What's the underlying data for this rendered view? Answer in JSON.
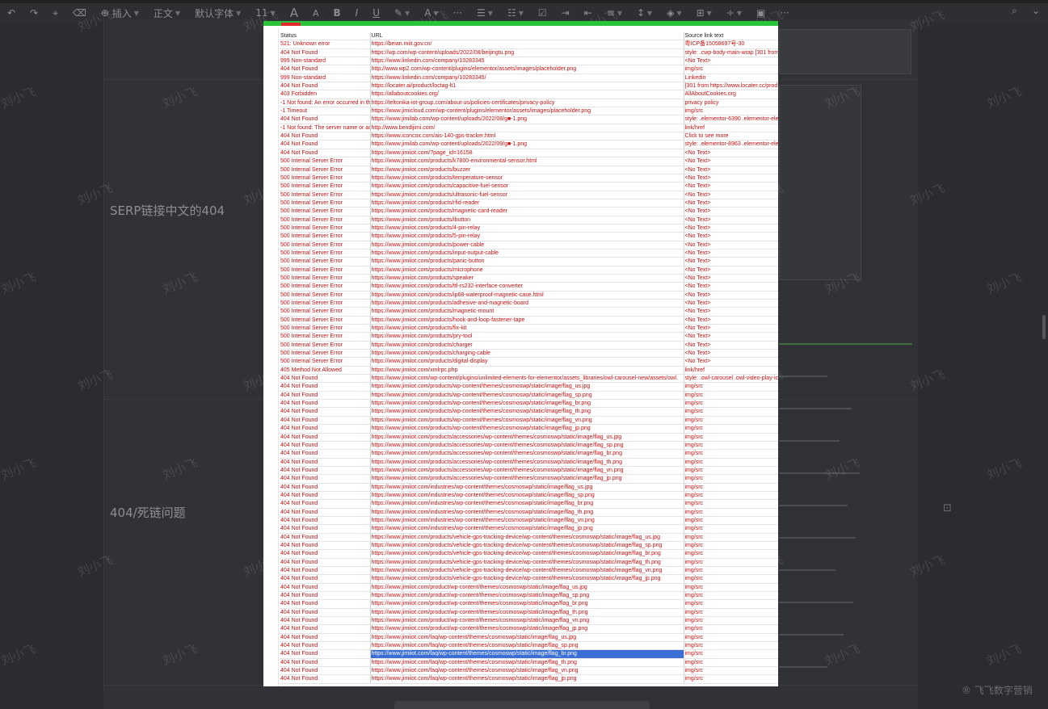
{
  "toolbar": {
    "insert_label": "插入",
    "style_label": "正文",
    "font_label": "默认字体",
    "size_label": "11",
    "bold": "B",
    "italic": "I",
    "underline": "U",
    "grow_font": "A",
    "shrink_font": "A",
    "more": "···"
  },
  "document": {
    "row_label_1": "SERP链接中文的404",
    "row_label_2": "404/死链问题"
  },
  "watermark": "刘小飞",
  "corner_text": "® 飞飞数字营销",
  "table": {
    "headers": [
      "Status",
      "URL",
      "Source link text"
    ],
    "selected_row": 73,
    "rows": [
      [
        "521: Unknown error",
        "https://beian.miit.gov.cn/",
        "粤ICP备15058697号-30"
      ],
      [
        "404 Not Found",
        "https://wp.com/wp-content/uploads/2022/08/beijingtu.png",
        "style: .cwp-body-main-wrap [301 from"
      ],
      [
        "999 Non-standard",
        "https://www.linkedin.com/company/10283345",
        "<No Text>"
      ],
      [
        "404 Not Found",
        "http://www.wp2.com/wp-content/plugins/elementor/assets/images/placeholder.png",
        "img/src"
      ],
      [
        "999 Non-standard",
        "https://www.linkedin.com/company/10283345/",
        "Linkedin"
      ],
      [
        "404 Not Found",
        "https://locater.ai/product/loctag-lt1",
        "[301 from https://www.locater.cc/prod"
      ],
      [
        "403 Forbidden",
        "https://allaboutcookies.org/",
        "AllAboutCookies.org"
      ],
      [
        "-1 Not found: An error occurred in th",
        "https://teltonika-iot-group.com/about-us/policies-certificates/privacy-policy",
        "privacy policy"
      ],
      [
        "-1 Timeout",
        "https://www.jimicloud.com/wp-content/plugins/elementor/assets/images/placeholder.png",
        "img/src"
      ],
      [
        "404 Not Found",
        "https://www.jimilab.com/wp-content/uploads/2022/08/g■-1.png",
        "style: .elementor-6390 .elementor-ele"
      ],
      [
        "-1 Not found: The server name or ad",
        "http://www.bendijimi.com/",
        "link/href"
      ],
      [
        "404 Not Found",
        "https://www.iconcox.com/ais-140-gps-tracker.html",
        "Click to see more"
      ],
      [
        "404 Not Found",
        "https://www.jimilab.com/wp-content/uploads/2022/09/g■-1.png",
        "style: .elementor-8963 .elementor-ele"
      ],
      [
        "404 Not Found",
        "https://www.jimiiot.com/?page_id=16158",
        "<No Text>"
      ],
      [
        "500 Internal Server Error",
        "https://www.jimiiot.com/products/k7800-environmental-sensor.html",
        "<No Text>"
      ],
      [
        "500 Internal Server Error",
        "https://www.jimiiot.com/products/buzzer",
        "<No Text>"
      ],
      [
        "500 Internal Server Error",
        "https://www.jimiiot.com/products/temperature-sensor",
        "<No Text>"
      ],
      [
        "500 Internal Server Error",
        "https://www.jimiiot.com/products/capacitive-fuel-sensor",
        "<No Text>"
      ],
      [
        "500 Internal Server Error",
        "https://www.jimiiot.com/products/ultrasonic-fuel-sensor",
        "<No Text>"
      ],
      [
        "500 Internal Server Error",
        "https://www.jimiiot.com/products/rfid-reader",
        "<No Text>"
      ],
      [
        "500 Internal Server Error",
        "https://www.jimiiot.com/products/magnetic-card-reader",
        "<No Text>"
      ],
      [
        "500 Internal Server Error",
        "https://www.jimiiot.com/products/ibutton",
        "<No Text>"
      ],
      [
        "500 Internal Server Error",
        "https://www.jimiiot.com/products/4-pin-relay",
        "<No Text>"
      ],
      [
        "500 Internal Server Error",
        "https://www.jimiiot.com/products/5-pin-relay",
        "<No Text>"
      ],
      [
        "500 Internal Server Error",
        "https://www.jimiiot.com/products/power-cable",
        "<No Text>"
      ],
      [
        "500 Internal Server Error",
        "https://www.jimiiot.com/products/input-output-cable",
        "<No Text>"
      ],
      [
        "500 Internal Server Error",
        "https://www.jimiiot.com/products/panic-button",
        "<No Text>"
      ],
      [
        "500 Internal Server Error",
        "https://www.jimiiot.com/products/microphone",
        "<No Text>"
      ],
      [
        "500 Internal Server Error",
        "https://www.jimiiot.com/products/speaker",
        "<No Text>"
      ],
      [
        "500 Internal Server Error",
        "https://www.jimiiot.com/products/ttl-rs232-interface-converter",
        "<No Text>"
      ],
      [
        "500 Internal Server Error",
        "https://www.jimiiot.com/products/ip68-waterproof-magnetic-case.html",
        "<No Text>"
      ],
      [
        "500 Internal Server Error",
        "https://www.jimiiot.com/products/adhesive-and-magnetic-board",
        "<No Text>"
      ],
      [
        "500 Internal Server Error",
        "https://www.jimiiot.com/products/magnetic-mount",
        "<No Text>"
      ],
      [
        "500 Internal Server Error",
        "https://www.jimiiot.com/products/hook-and-loop-fastener-tape",
        "<No Text>"
      ],
      [
        "500 Internal Server Error",
        "https://www.jimiiot.com/products/fix-kit",
        "<No Text>"
      ],
      [
        "500 Internal Server Error",
        "https://www.jimiiot.com/products/pry-tool",
        "<No Text>"
      ],
      [
        "500 Internal Server Error",
        "https://www.jimiiot.com/products/charger",
        "<No Text>"
      ],
      [
        "500 Internal Server Error",
        "https://www.jimiiot.com/products/charging-cable",
        "<No Text>"
      ],
      [
        "500 Internal Server Error",
        "https://www.jimiiot.com/products/digital-display",
        "<No Text>"
      ],
      [
        "405 Method Not Allowed",
        "https://www.jimiiot.com/xmlrpc.php",
        "link/href"
      ],
      [
        "404 Not Found",
        "https://www.jimiiot.com/wp-content/plugins/unlimited-elements-for-elementor/assets_libraries/owl-carousel-new/assets/owl.",
        "style: .owl-carousel .owl-video-play-ic"
      ],
      [
        "404 Not Found",
        "https://www.jimiiot.com/products/wp-content/themes/cosmoswp/static/image/flag_us.jpg",
        "img/src"
      ],
      [
        "404 Not Found",
        "https://www.jimiiot.com/products/wp-content/themes/cosmoswp/static/image/flag_sp.png",
        "img/src"
      ],
      [
        "404 Not Found",
        "https://www.jimiiot.com/products/wp-content/themes/cosmoswp/static/image/flag_br.png",
        "img/src"
      ],
      [
        "404 Not Found",
        "https://www.jimiiot.com/products/wp-content/themes/cosmoswp/static/image/flag_th.png",
        "img/src"
      ],
      [
        "404 Not Found",
        "https://www.jimiiot.com/products/wp-content/themes/cosmoswp/static/image/flag_vn.png",
        "img/src"
      ],
      [
        "404 Not Found",
        "https://www.jimiiot.com/products/wp-content/themes/cosmoswp/static/image/flag_jp.png",
        "img/src"
      ],
      [
        "404 Not Found",
        "https://www.jimiiot.com/products/accessories/wp-content/themes/cosmoswp/static/image/flag_us.jpg",
        "img/src"
      ],
      [
        "404 Not Found",
        "https://www.jimiiot.com/products/accessories/wp-content/themes/cosmoswp/static/image/flag_sp.png",
        "img/src"
      ],
      [
        "404 Not Found",
        "https://www.jimiiot.com/products/accessories/wp-content/themes/cosmoswp/static/image/flag_br.png",
        "img/src"
      ],
      [
        "404 Not Found",
        "https://www.jimiiot.com/products/accessories/wp-content/themes/cosmoswp/static/image/flag_th.png",
        "img/src"
      ],
      [
        "404 Not Found",
        "https://www.jimiiot.com/products/accessories/wp-content/themes/cosmoswp/static/image/flag_vn.png",
        "img/src"
      ],
      [
        "404 Not Found",
        "https://www.jimiiot.com/products/accessories/wp-content/themes/cosmoswp/static/image/flag_jp.png",
        "img/src"
      ],
      [
        "404 Not Found",
        "https://www.jimiiot.com/industries/wp-content/themes/cosmoswp/static/image/flag_us.jpg",
        "img/src"
      ],
      [
        "404 Not Found",
        "https://www.jimiiot.com/industries/wp-content/themes/cosmoswp/static/image/flag_sp.png",
        "img/src"
      ],
      [
        "404 Not Found",
        "https://www.jimiiot.com/industries/wp-content/themes/cosmoswp/static/image/flag_br.png",
        "img/src"
      ],
      [
        "404 Not Found",
        "https://www.jimiiot.com/industries/wp-content/themes/cosmoswp/static/image/flag_th.png",
        "img/src"
      ],
      [
        "404 Not Found",
        "https://www.jimiiot.com/industries/wp-content/themes/cosmoswp/static/image/flag_vn.png",
        "img/src"
      ],
      [
        "404 Not Found",
        "https://www.jimiiot.com/industries/wp-content/themes/cosmoswp/static/image/flag_jp.png",
        "img/src"
      ],
      [
        "404 Not Found",
        "https://www.jimiiot.com/products/vehicle-gps-tracking-device/wp-content/themes/cosmoswp/static/image/flag_us.jpg",
        "img/src"
      ],
      [
        "404 Not Found",
        "https://www.jimiiot.com/products/vehicle-gps-tracking-device/wp-content/themes/cosmoswp/static/image/flag_sp.png",
        "img/src"
      ],
      [
        "404 Not Found",
        "https://www.jimiiot.com/products/vehicle-gps-tracking-device/wp-content/themes/cosmoswp/static/image/flag_br.png",
        "img/src"
      ],
      [
        "404 Not Found",
        "https://www.jimiiot.com/products/vehicle-gps-tracking-device/wp-content/themes/cosmoswp/static/image/flag_th.png",
        "img/src"
      ],
      [
        "404 Not Found",
        "https://www.jimiiot.com/products/vehicle-gps-tracking-device/wp-content/themes/cosmoswp/static/image/flag_vn.png",
        "img/src"
      ],
      [
        "404 Not Found",
        "https://www.jimiiot.com/products/vehicle-gps-tracking-device/wp-content/themes/cosmoswp/static/image/flag_jp.png",
        "img/src"
      ],
      [
        "404 Not Found",
        "https://www.jimiiot.com/product/wp-content/themes/cosmoswp/static/image/flag_us.jpg",
        "img/src"
      ],
      [
        "404 Not Found",
        "https://www.jimiiot.com/product/wp-content/themes/cosmoswp/static/image/flag_sp.png",
        "img/src"
      ],
      [
        "404 Not Found",
        "https://www.jimiiot.com/product/wp-content/themes/cosmoswp/static/image/flag_br.png",
        "img/src"
      ],
      [
        "404 Not Found",
        "https://www.jimiiot.com/product/wp-content/themes/cosmoswp/static/image/flag_th.png",
        "img/src"
      ],
      [
        "404 Not Found",
        "https://www.jimiiot.com/product/wp-content/themes/cosmoswp/static/image/flag_vn.png",
        "img/src"
      ],
      [
        "404 Not Found",
        "https://www.jimiiot.com/product/wp-content/themes/cosmoswp/static/image/flag_jp.png",
        "img/src"
      ],
      [
        "404 Not Found",
        "https://www.jimiiot.com/faq/wp-content/themes/cosmoswp/static/image/flag_us.jpg",
        "img/src"
      ],
      [
        "404 Not Found",
        "https://www.jimiiot.com/faq/wp-content/themes/cosmoswp/static/image/flag_sp.png",
        "img/src"
      ],
      [
        "404 Not Found",
        "https://www.jimiiot.com/faq/wp-content/themes/cosmoswp/static/image/flag_br.png",
        "img/src"
      ],
      [
        "404 Not Found",
        "https://www.jimiiot.com/faq/wp-content/themes/cosmoswp/static/image/flag_th.png",
        "img/src"
      ],
      [
        "404 Not Found",
        "https://www.jimiiot.com/faq/wp-content/themes/cosmoswp/static/image/flag_vn.png",
        "img/src"
      ],
      [
        "404 Not Found",
        "https://www.jimiiot.com/faq/wp-content/themes/cosmoswp/static/image/flag_jp.png",
        "img/src"
      ]
    ]
  },
  "colors": {
    "error_text": "#c41212",
    "selection": "#3b6fd6",
    "progress_green": "#29c43a",
    "progress_red": "#e02a2a"
  }
}
